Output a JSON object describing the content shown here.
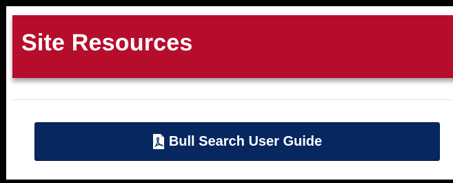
{
  "panel": {
    "title": "Site Resources"
  },
  "resources": [
    {
      "label": "Bull Search User Guide",
      "icon": "pdf-file-icon"
    }
  ],
  "colors": {
    "header": "#b70d2d",
    "button": "#06275f",
    "button_text": "#ffffff",
    "frame": "#000000"
  }
}
